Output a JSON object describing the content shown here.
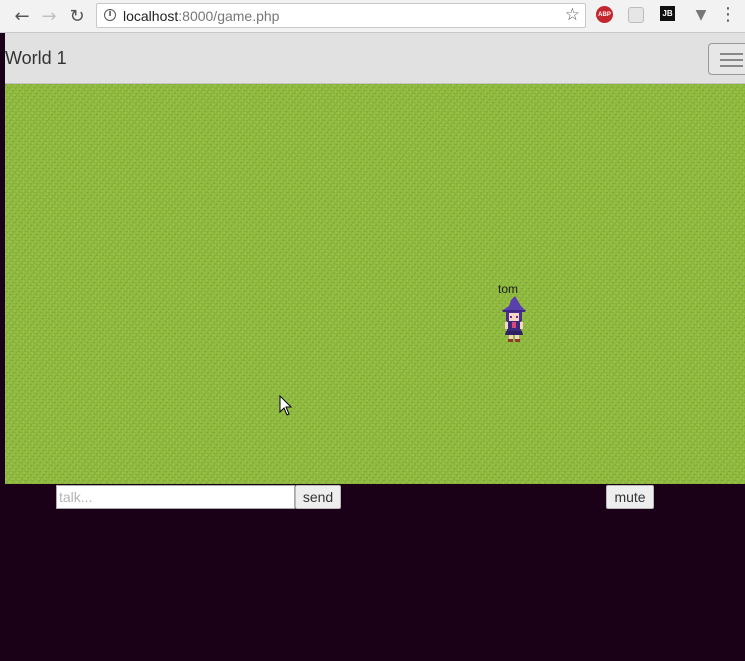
{
  "browser": {
    "url_host": "localhost",
    "url_rest": ":8000/game.php",
    "back_icon": "arrow-left-icon",
    "forward_icon": "arrow-right-icon",
    "reload_icon": "reload-icon",
    "extensions": {
      "abp_label": "ABP",
      "jb_label": "JB"
    }
  },
  "header": {
    "title": "World 1"
  },
  "game": {
    "player_name": "tom"
  },
  "chat": {
    "placeholder": "talk...",
    "value": "",
    "send_label": "send",
    "mute_label": "mute"
  },
  "colors": {
    "grass": "#8fbb3c",
    "page_background": "#1b0117",
    "header_background": "#e1e1e1"
  }
}
